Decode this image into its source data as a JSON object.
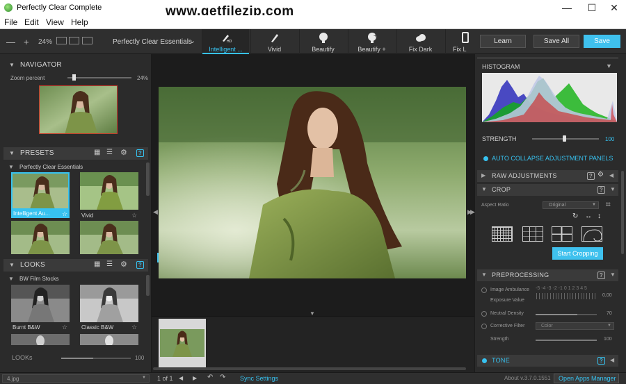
{
  "window": {
    "title": "Perfectly Clear Complete",
    "watermark": "www.getfilezip.com",
    "controls": {
      "minimize": "—",
      "maximize": "☐",
      "close": "✕"
    }
  },
  "menu": [
    "File",
    "Edit",
    "View",
    "Help"
  ],
  "toolbar": {
    "zoom_minus": "—",
    "zoom_plus": "+",
    "zoom_value": "24%",
    "preset_set": "Perfectly Clear Essentials",
    "preset_set_chevron": "⌄",
    "tabs": [
      {
        "label": "Intelligent ...",
        "icon": "brush-hd-icon",
        "active": true
      },
      {
        "label": "Vivid",
        "icon": "brush-icon",
        "active": false
      },
      {
        "label": "Beautify",
        "icon": "face-icon",
        "active": false
      },
      {
        "label": "Beautify +",
        "icon": "face-plus-icon",
        "active": false
      },
      {
        "label": "Fix Dark",
        "icon": "cloud-icon",
        "active": false
      },
      {
        "label": "Fix L",
        "icon": "phone-icon",
        "active": false
      }
    ],
    "learn": "Learn",
    "save_all": "Save All",
    "save": "Save"
  },
  "navigator": {
    "title": "NAVIGATOR",
    "zoom_label": "Zoom percent",
    "zoom_value": "24%",
    "zoom_fraction": 0.08
  },
  "presets": {
    "title": "PRESETS",
    "group": "Perfectly Clear Essentials",
    "items": [
      "Intelligent Au...",
      "Vivid"
    ]
  },
  "looks": {
    "title": "LOOKS",
    "group": "BW Film Stocks",
    "items": [
      "Burnt B&W",
      "Classic B&W"
    ],
    "strength_label": "LOOKs",
    "strength_value": "100"
  },
  "right": {
    "histogram_title": "HISTOGRAM",
    "strength_label": "STRENGTH",
    "strength_value": "100",
    "auto_collapse": "AUTO COLLAPSE ADJUSTMENT PANELS",
    "raw_adjustments": "RAW ADJUSTMENTS",
    "crop_title": "CROP",
    "aspect_ratio_label": "Aspect Ratio",
    "aspect_ratio_value": "Original",
    "start_cropping": "Start Cropping",
    "preprocessing_title": "PREPROCESSING",
    "image_ambulance": "Image Ambulance",
    "ambulance_scale": "-5 -4 -3 -2 -1 0 1 2 3 4 5",
    "exposure_value_label": "Exposure Value",
    "exposure_value": "0,00",
    "neutral_density": "Neutral Density",
    "neutral_density_value": "70",
    "corrective_filter": "Corrective Filter",
    "corrective_filter_value": "Color",
    "strength2_label": "Strength",
    "strength2_value": "100",
    "tone_title": "TONE"
  },
  "status": {
    "filename": "4.jpg",
    "page": "1 of 1",
    "sync": "Sync Settings",
    "about": "About v.3.7.0.1551",
    "open_apps": "Open Apps Manager"
  },
  "colors": {
    "accent": "#37c2f0",
    "panel": "#2b2b2b",
    "header": "#3a3a3a"
  }
}
